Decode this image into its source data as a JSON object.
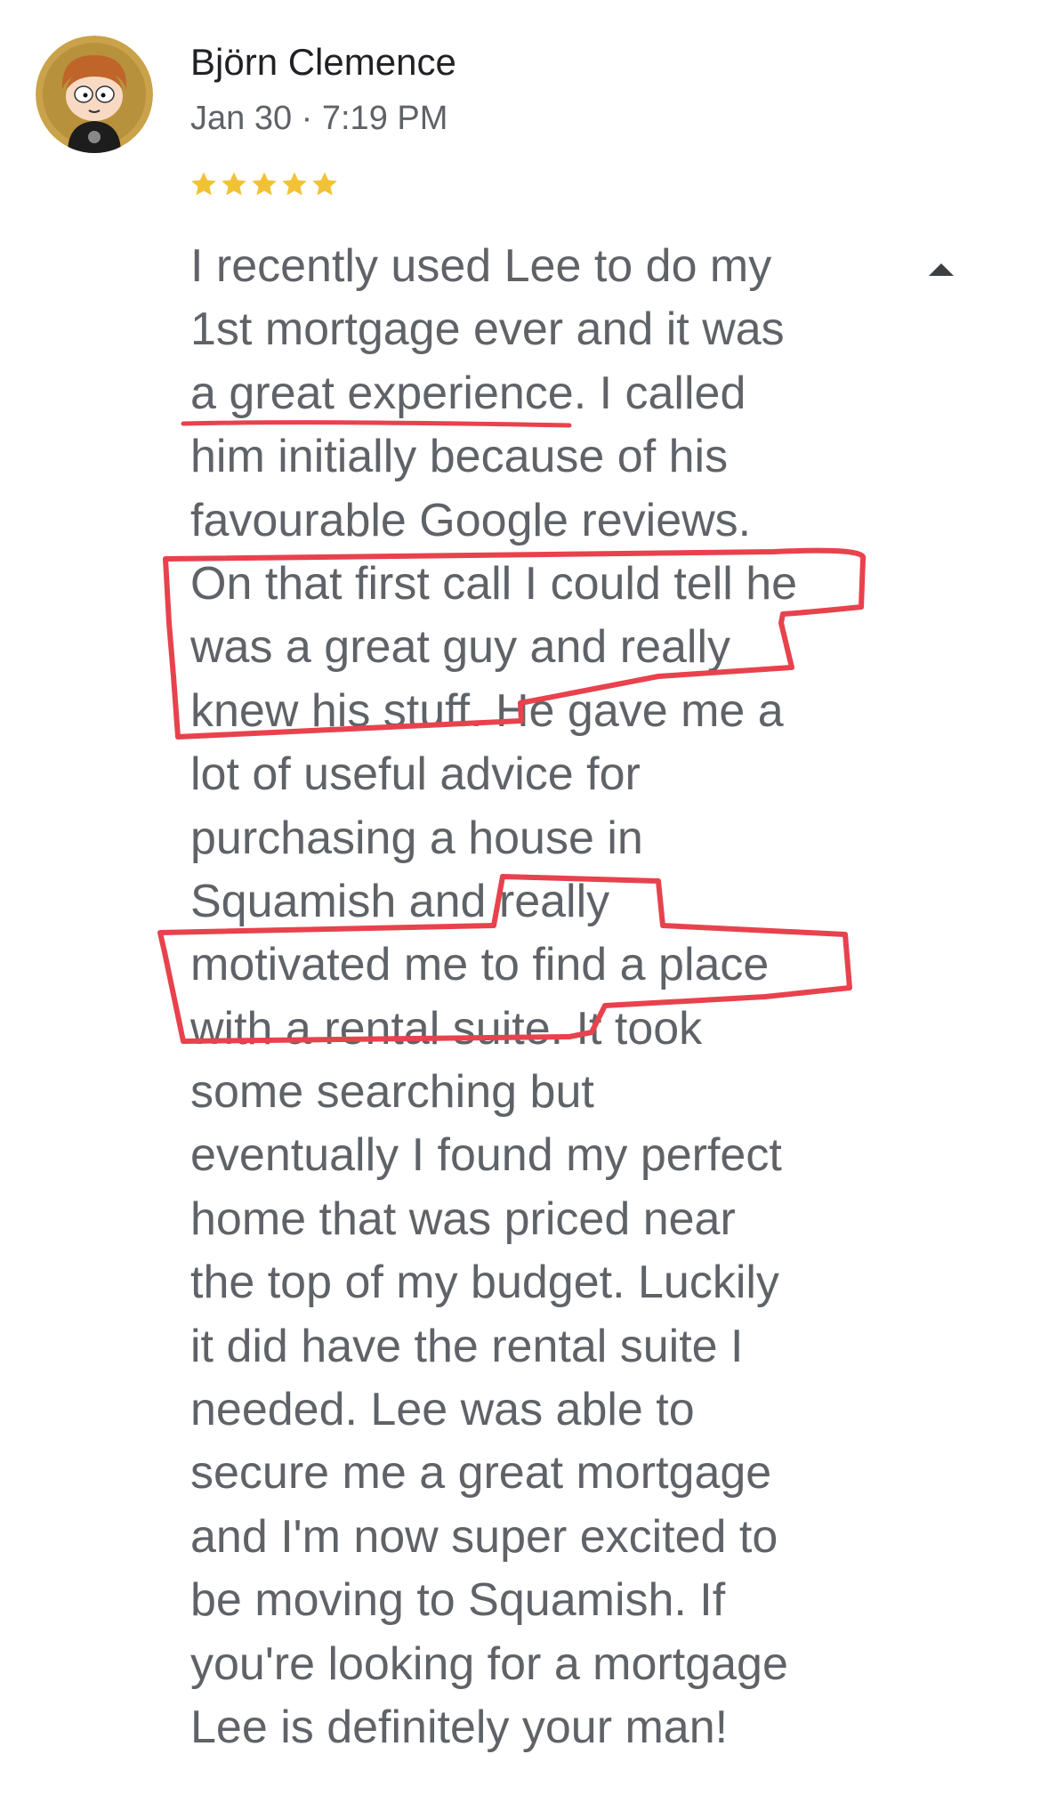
{
  "review": {
    "reviewer_name": "Björn Clemence",
    "time": "Jan 30 · 7:19 PM",
    "rating": 5,
    "rating_max": 5,
    "colors": {
      "star": "#f2c236",
      "annotation": "#e8424d",
      "name": "#202124",
      "text": "#5f6368"
    },
    "icons": {
      "avatar": "cartoon-avatar-icon",
      "star": "star-icon",
      "collapse": "caret-up-icon"
    },
    "lines": [
      "I recently used Lee to do my",
      "1st mortgage ever and it was",
      "a great experience. I called",
      "him initially because of his",
      "favourable Google reviews.",
      "On that first call I could tell he",
      "was a great guy and really",
      "knew his stuff. He gave me a",
      "lot of useful advice for",
      "purchasing a house in",
      "Squamish and really",
      "motivated me to find a place",
      "with a rental suite. It took",
      "some searching but",
      "eventually I found my perfect",
      "home that was priced near",
      "the top of my budget. Luckily",
      "it did have the rental suite I",
      "needed. Lee was able to",
      "secure me a great mortgage",
      "and I'm now super excited to",
      "be moving to Squamish. If",
      "you're looking for a mortgage",
      "Lee is definitely your man!"
    ]
  }
}
